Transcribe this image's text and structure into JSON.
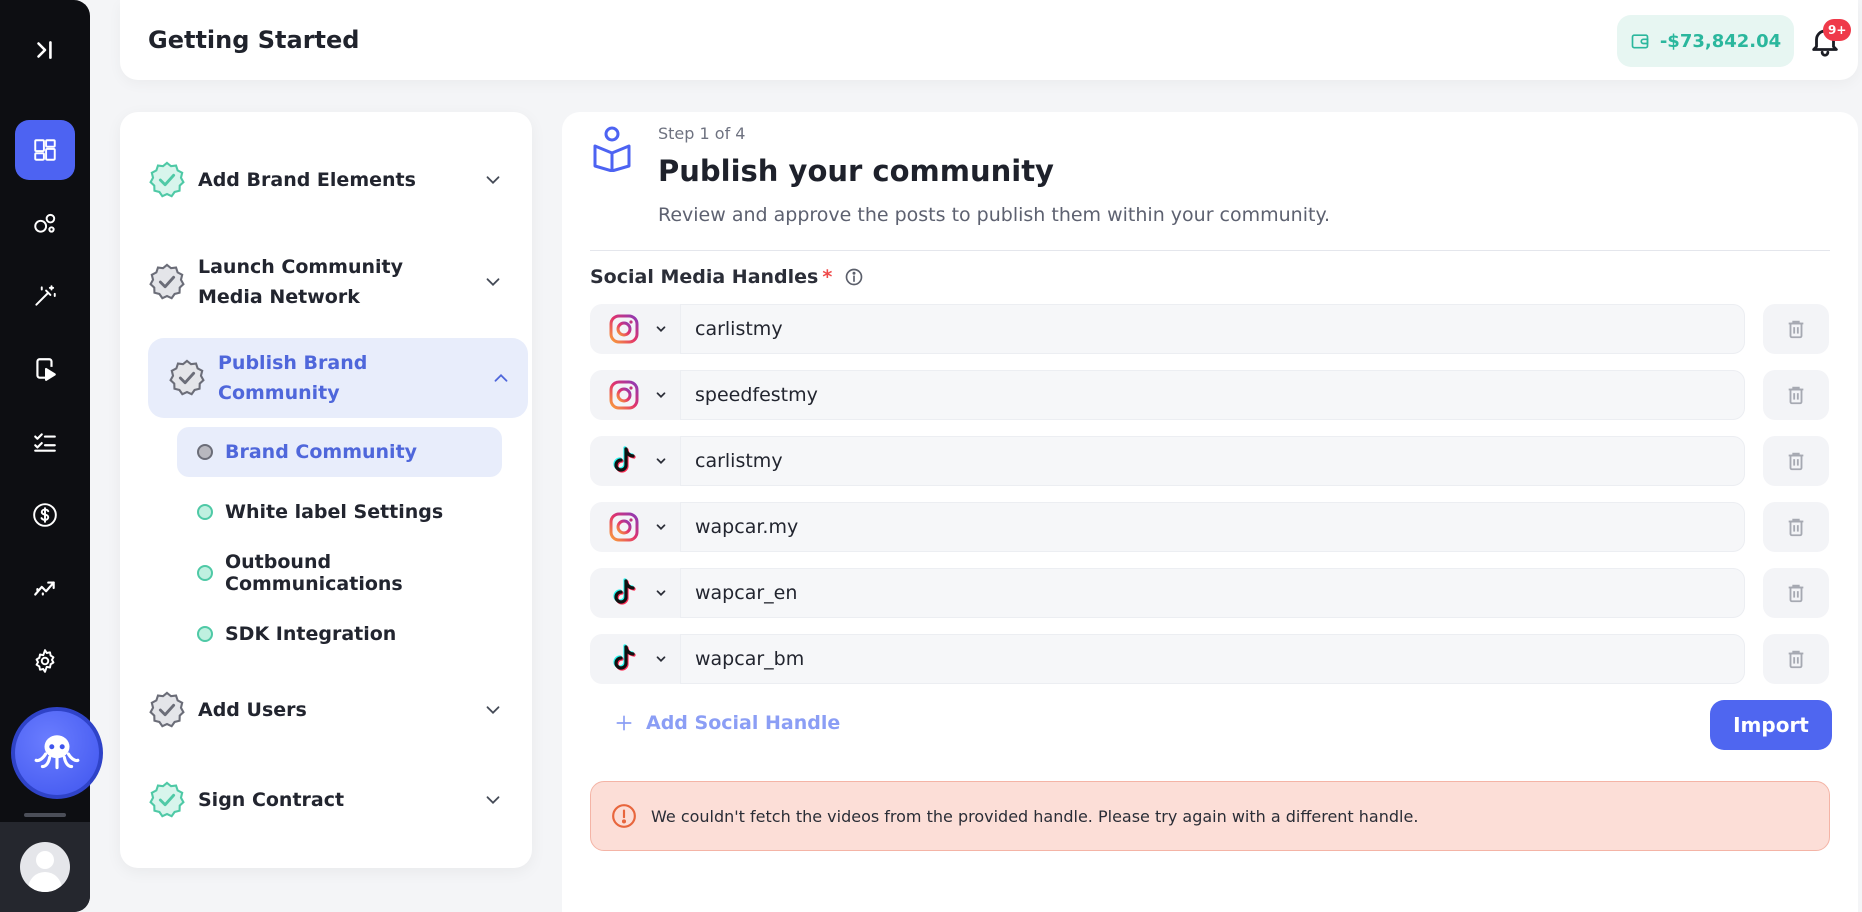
{
  "header": {
    "title": "Getting Started",
    "balance": "-$73,842.04",
    "notification_badge": "9+"
  },
  "nav": {
    "items": [
      {
        "icon": "collapse-sidebar-icon"
      },
      {
        "icon": "dashboard-icon",
        "active": true
      },
      {
        "icon": "community-icon"
      },
      {
        "icon": "magic-wand-icon"
      },
      {
        "icon": "mobile-video-icon"
      },
      {
        "icon": "checklist-icon"
      },
      {
        "icon": "dollar-icon"
      },
      {
        "icon": "analytics-icon"
      },
      {
        "icon": "settings-icon"
      }
    ],
    "accent_color": "#4d63f2"
  },
  "steps": [
    {
      "label": "Add Brand Elements",
      "status": "complete"
    },
    {
      "label": "Launch Community Media Network",
      "status": "pending"
    },
    {
      "label": "Publish Brand Community",
      "status": "in-progress",
      "expanded": true,
      "substeps": [
        {
          "label": "Brand Community",
          "active": true
        },
        {
          "label": "White label Settings"
        },
        {
          "label": "Outbound Communications"
        },
        {
          "label": "SDK Integration"
        }
      ]
    },
    {
      "label": "Add Users",
      "status": "pending"
    },
    {
      "label": "Sign Contract",
      "status": "complete"
    }
  ],
  "main": {
    "step_count": "Step 1 of 4",
    "title": "Publish your community",
    "subtitle": "Review and approve the posts to publish them within your community.",
    "field_label": "Social Media Handles",
    "required_mark": "*",
    "handles": [
      {
        "platform": "instagram",
        "value": "carlistmy"
      },
      {
        "platform": "instagram",
        "value": "speedfestmy"
      },
      {
        "platform": "tiktok",
        "value": "carlistmy"
      },
      {
        "platform": "instagram",
        "value": "wapcar.my"
      },
      {
        "platform": "tiktok",
        "value": "wapcar_en"
      },
      {
        "platform": "tiktok",
        "value": "wapcar_bm"
      }
    ],
    "add_handle_label": "Add Social Handle",
    "import_label": "Import",
    "error_message": "We couldn't fetch the videos from the provided handle. Please try again with a different handle."
  },
  "colors": {
    "complete": "#4fc9a6",
    "pending": "#6b6d78",
    "primary": "#4f66f0",
    "error_bg": "#fcded7"
  }
}
